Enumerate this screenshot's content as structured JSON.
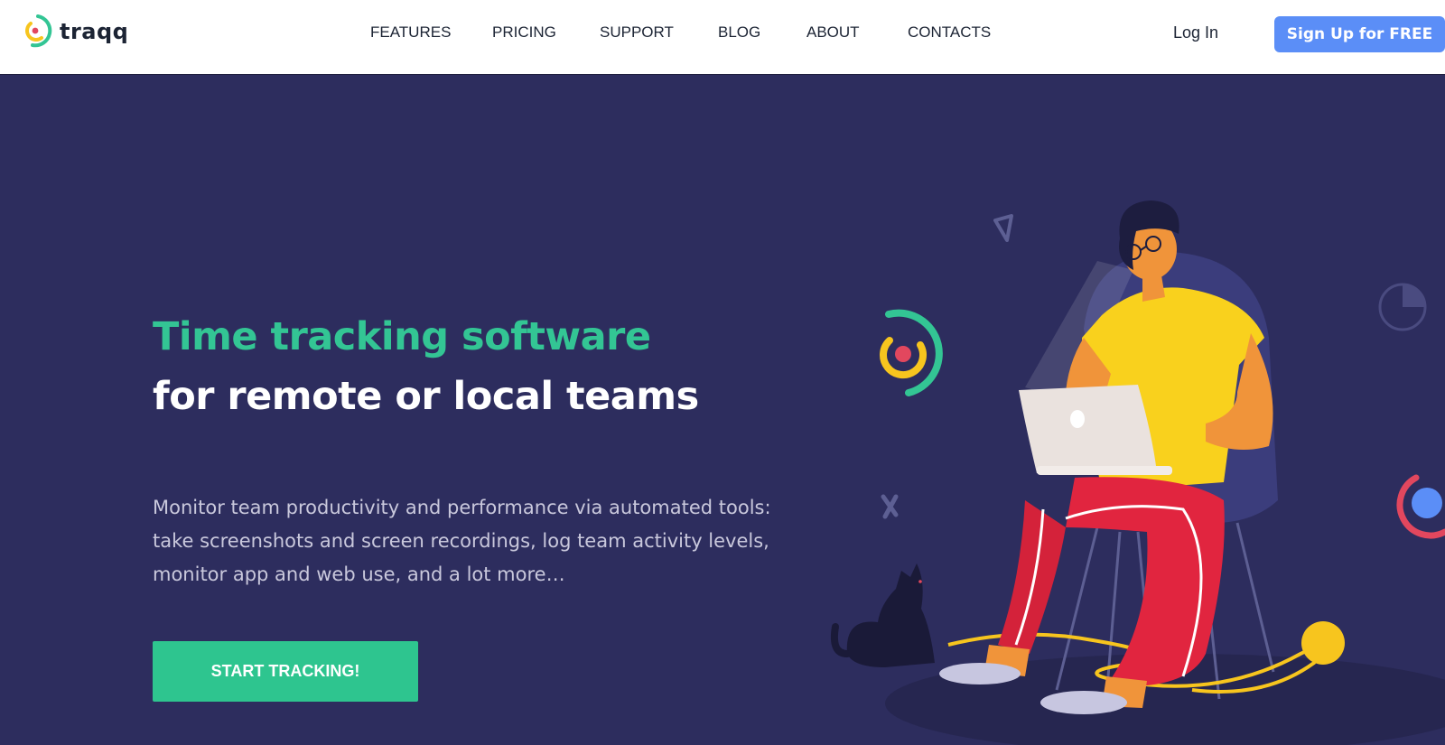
{
  "brand": {
    "name": "traqq"
  },
  "nav": {
    "items": [
      {
        "label": "FEATURES"
      },
      {
        "label": "PRICING"
      },
      {
        "label": "SUPPORT"
      },
      {
        "label": "BLOG"
      },
      {
        "label": "ABOUT"
      },
      {
        "label": "CONTACTS"
      }
    ],
    "login_label": "Log In",
    "signup_label": "Sign Up for FREE"
  },
  "hero": {
    "headline_line1": "Time tracking software",
    "headline_line2": "for remote or local teams",
    "description": "Monitor team productivity and performance via automated tools: take screenshots and screen recordings, log team activity levels, monitor app and web use, and a lot more…",
    "cta_label": "START TRACKING!"
  },
  "colors": {
    "brand_green": "#33c594",
    "brand_yellow": "#f7c51e",
    "brand_red": "#e2475e",
    "accent_blue": "#5b8ef7",
    "hero_background": "#2d2d5e"
  },
  "icons": {
    "logo": "traqq-logo-icon",
    "decor": [
      "triangle-icon",
      "cross-icon",
      "pie-chart-icon",
      "ring-icon"
    ]
  }
}
